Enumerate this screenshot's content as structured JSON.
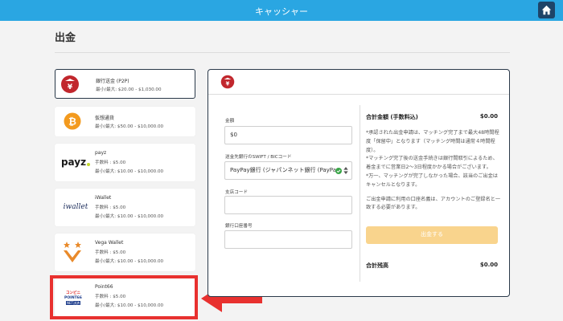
{
  "header": {
    "title": "キャッシャー",
    "home_icon": "home-icon"
  },
  "page": {
    "title": "出金"
  },
  "methods": [
    {
      "name": "銀行送金 (P2P)",
      "limit": "最小/最大: $20.00 - $1,030.00",
      "icon": "bank-yen-icon",
      "selected": true
    },
    {
      "name": "仮想通貨",
      "limit": "最小/最大: $50.00 - $10,000.00",
      "icon": "bitcoin-icon"
    },
    {
      "name": "payz",
      "fee": "手数料 : $5.00",
      "limit": "最小/最大: $10.00 - $10,000.00",
      "icon": "payz-logo"
    },
    {
      "name": "iWallet",
      "fee": "手数料 : $5.00",
      "limit": "最小/最大: $10.00 - $10,000.00",
      "icon": "iwallet-logo"
    },
    {
      "name": "Vega Wallet",
      "fee": "手数料 : $5.00",
      "limit": "最小/最大: $10.00 - $10,000.00",
      "icon": "vega-wallet-logo"
    },
    {
      "name": "Point66",
      "fee": "手数料 : $5.00",
      "limit": "最小/最大: $10.00 - $10,000.00",
      "icon": "point66-logo"
    }
  ],
  "logos": {
    "payz": "payz",
    "iwallet": "iwallet",
    "point66_top": "コンビニ",
    "point66_mid": "POINT66",
    "point66_bot": "NET決済"
  },
  "form": {
    "amount_label": "金額",
    "amount_value": "$0",
    "bank_label": "送金先銀行のSWIFT / BICコード",
    "bank_value": "PayPay銀行 (ジャパンネット銀行 (PayPay",
    "branch_label": "支店コード",
    "branch_value": "",
    "account_label": "銀行口座番号",
    "account_value": ""
  },
  "summary": {
    "total_label": "合計金額 (手数料込)",
    "total_value": "$0.00",
    "notes": [
      "*承認された出金申請は、マッチング完了まで最大48時間程度「保留中」となります（マッチング時間は通常４時間程度）。",
      "*マッチング完了後の送金手続きは銀行間取引によるため、着金までに営業日2～3日程度かかる場合がございます。",
      "*万一、マッチングが完了しなかった場合、該当のご出金はキャンセルとなります。",
      "ご出金申請に利用の口座名義は、アカウントのご登録名と一致する必要があります。"
    ],
    "submit_label": "出金する",
    "balance_label": "合計残高",
    "balance_value": "$0.00"
  },
  "colors": {
    "header": "#2aa6e2",
    "home": "#1e4468",
    "highlight": "#e8312f",
    "submit": "#f9d48d",
    "bitcoin": "#f39a1e",
    "bank_icon": "#c1272d"
  }
}
